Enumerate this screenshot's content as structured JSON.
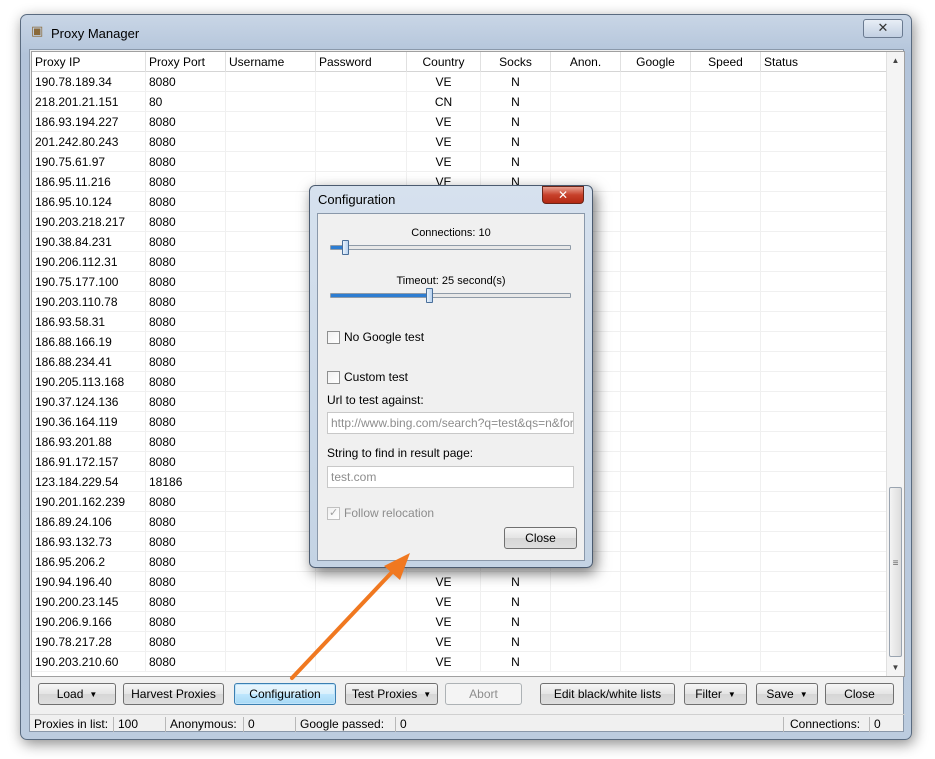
{
  "window": {
    "title": "Proxy Manager",
    "icon": "box-icon",
    "close_label": "✕"
  },
  "table": {
    "columns": [
      "Proxy IP",
      "Proxy Port",
      "Username",
      "Password",
      "Country",
      "Socks",
      "Anon.",
      "Google",
      "Speed",
      "Status"
    ],
    "rows": [
      [
        "190.78.189.34",
        "8080",
        "",
        "",
        "VE",
        "N"
      ],
      [
        "218.201.21.151",
        "80",
        "",
        "",
        "CN",
        "N"
      ],
      [
        "186.93.194.227",
        "8080",
        "",
        "",
        "VE",
        "N"
      ],
      [
        "201.242.80.243",
        "8080",
        "",
        "",
        "VE",
        "N"
      ],
      [
        "190.75.61.97",
        "8080",
        "",
        "",
        "VE",
        "N"
      ],
      [
        "186.95.11.216",
        "8080",
        "",
        "",
        "VE",
        "N"
      ],
      [
        "186.95.10.124",
        "8080",
        "",
        "",
        "",
        ""
      ],
      [
        "190.203.218.217",
        "8080",
        "",
        "",
        "",
        ""
      ],
      [
        "190.38.84.231",
        "8080",
        "",
        "",
        "",
        ""
      ],
      [
        "190.206.112.31",
        "8080",
        "",
        "",
        "",
        ""
      ],
      [
        "190.75.177.100",
        "8080",
        "",
        "",
        "",
        ""
      ],
      [
        "190.203.110.78",
        "8080",
        "",
        "",
        "",
        ""
      ],
      [
        "186.93.58.31",
        "8080",
        "",
        "",
        "",
        ""
      ],
      [
        "186.88.166.19",
        "8080",
        "",
        "",
        "",
        ""
      ],
      [
        "186.88.234.41",
        "8080",
        "",
        "",
        "",
        ""
      ],
      [
        "190.205.113.168",
        "8080",
        "",
        "",
        "",
        ""
      ],
      [
        "190.37.124.136",
        "8080",
        "",
        "",
        "",
        ""
      ],
      [
        "190.36.164.119",
        "8080",
        "",
        "",
        "",
        ""
      ],
      [
        "186.93.201.88",
        "8080",
        "",
        "",
        "",
        ""
      ],
      [
        "186.91.172.157",
        "8080",
        "",
        "",
        "",
        ""
      ],
      [
        "123.184.229.54",
        "18186",
        "",
        "",
        "",
        ""
      ],
      [
        "190.201.162.239",
        "8080",
        "",
        "",
        "",
        ""
      ],
      [
        "186.89.24.106",
        "8080",
        "",
        "",
        "",
        ""
      ],
      [
        "186.93.132.73",
        "8080",
        "",
        "",
        "",
        ""
      ],
      [
        "186.95.206.2",
        "8080",
        "",
        "",
        "",
        ""
      ],
      [
        "190.94.196.40",
        "8080",
        "",
        "",
        "VE",
        "N"
      ],
      [
        "190.200.23.145",
        "8080",
        "",
        "",
        "VE",
        "N"
      ],
      [
        "190.206.9.166",
        "8080",
        "",
        "",
        "VE",
        "N"
      ],
      [
        "190.78.217.28",
        "8080",
        "",
        "",
        "VE",
        "N"
      ],
      [
        "190.203.210.60",
        "8080",
        "",
        "",
        "VE",
        "N"
      ]
    ]
  },
  "toolbar": {
    "load": "Load",
    "harvest": "Harvest Proxies",
    "configuration": "Configuration",
    "test": "Test Proxies",
    "abort": "Abort",
    "edit_lists": "Edit black/white lists",
    "filter": "Filter",
    "save": "Save",
    "close": "Close"
  },
  "status": {
    "proxies_label": "Proxies in list:",
    "proxies_value": "100",
    "anon_label": "Anonymous:",
    "anon_value": "0",
    "google_label": "Google passed:",
    "google_value": "0",
    "connections_label": "Connections:",
    "connections_value": "0"
  },
  "dialog": {
    "title": "Configuration",
    "close_glyph": "✕",
    "connections_label": "Connections: 10",
    "connections_value": 10,
    "timeout_label": "Timeout: 25 second(s)",
    "timeout_value": 25,
    "no_google_label": "No Google test",
    "no_google_checked": false,
    "custom_test_label": "Custom test",
    "custom_test_checked": false,
    "url_label": "Url to test against:",
    "url_value": "http://www.bing.com/search?q=test&qs=n&form",
    "find_label": "String to find in result page:",
    "find_value": "test.com",
    "follow_label": "Follow relocation",
    "follow_checked": true,
    "close_button": "Close"
  },
  "colors": {
    "accent": "#2d7dd2",
    "annotation_arrow": "#f07820",
    "dialog_close": "#c7402a"
  }
}
